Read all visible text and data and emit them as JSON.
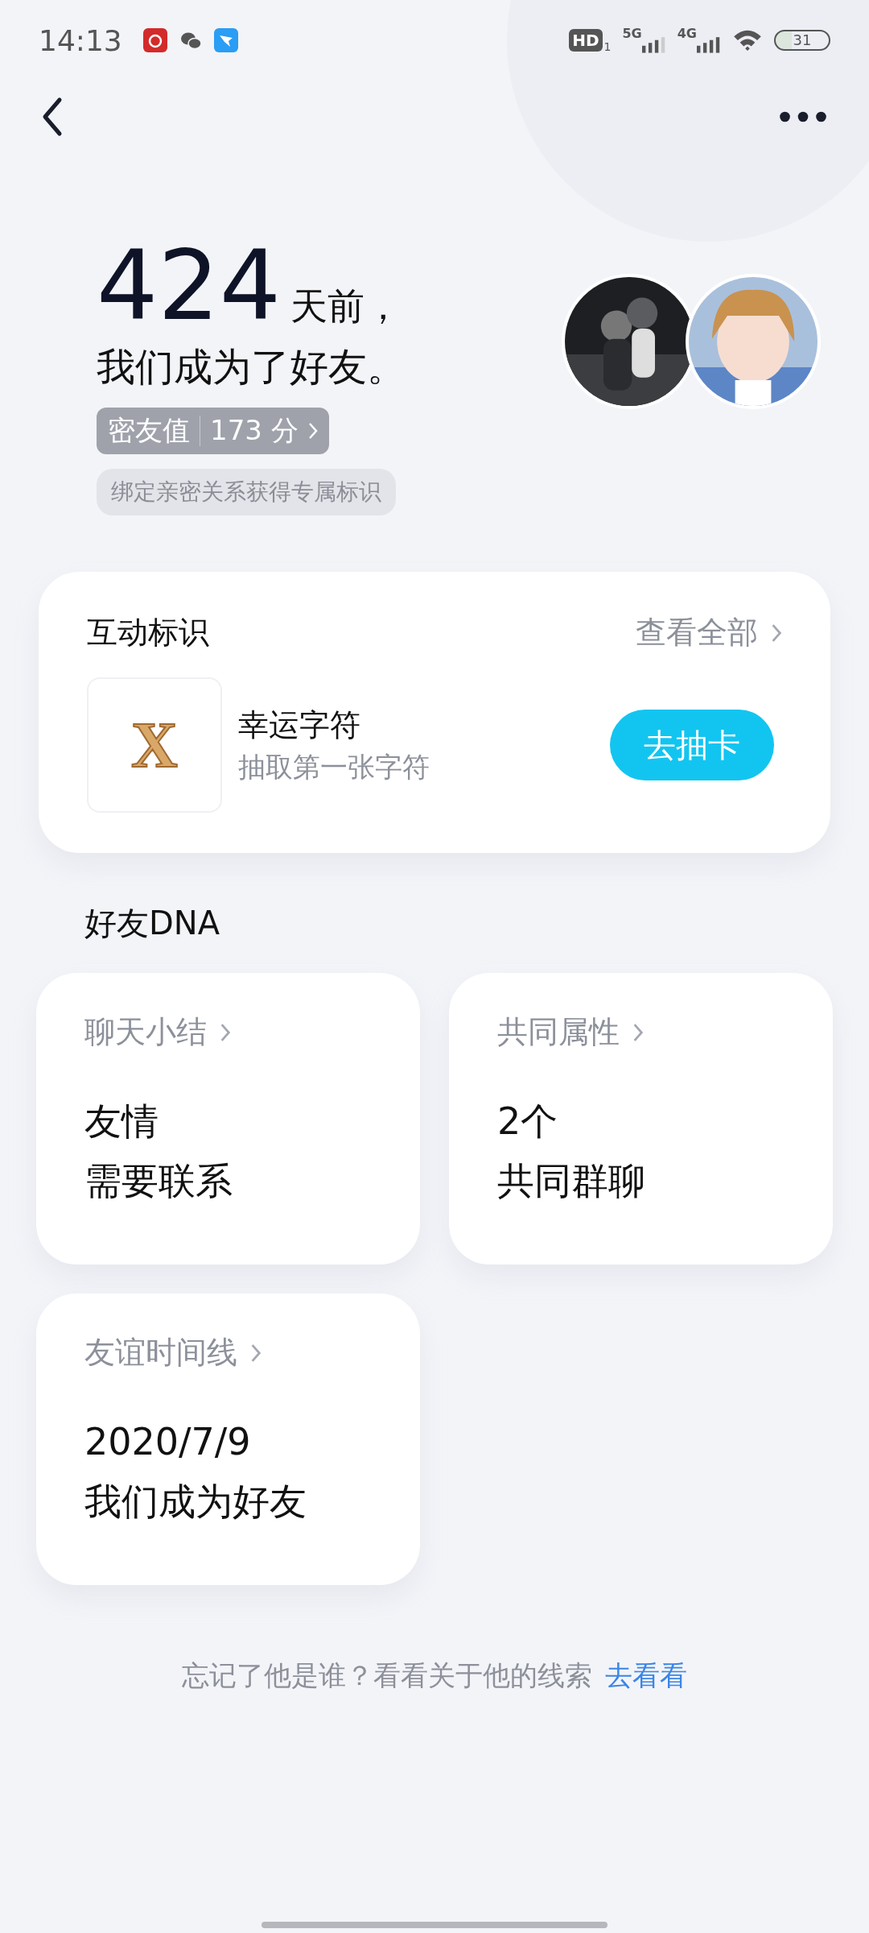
{
  "status_bar": {
    "time": "14:13",
    "hd": "HD",
    "hd_sub": "1",
    "network_1": "5G",
    "network_2": "4G",
    "battery": "31"
  },
  "header": {
    "days": "424",
    "days_suffix": "天前，",
    "sentence": "我们成为了好友。",
    "score_label": "密友值",
    "score_value": "173 分",
    "tip": "绑定亲密关系获得专属标识"
  },
  "interaction_card": {
    "title": "互动标识",
    "view_all": "查看全部",
    "badge_glyph": "X",
    "badge_name": "幸运字符",
    "badge_desc": "抽取第一张字符",
    "action": "去抽卡"
  },
  "dna_title": "好友DNA",
  "dna_cards": [
    {
      "title": "聊天小结",
      "line_1": "友情",
      "line_2": "需要联系"
    },
    {
      "title": "共同属性",
      "line_1": "2个",
      "line_2": "共同群聊"
    },
    {
      "title": "友谊时间线",
      "line_1": "2020/7/9",
      "line_2": "我们成为好友"
    }
  ],
  "footer": {
    "text": "忘记了他是谁？看看关于他的线索",
    "link": "去看看"
  }
}
